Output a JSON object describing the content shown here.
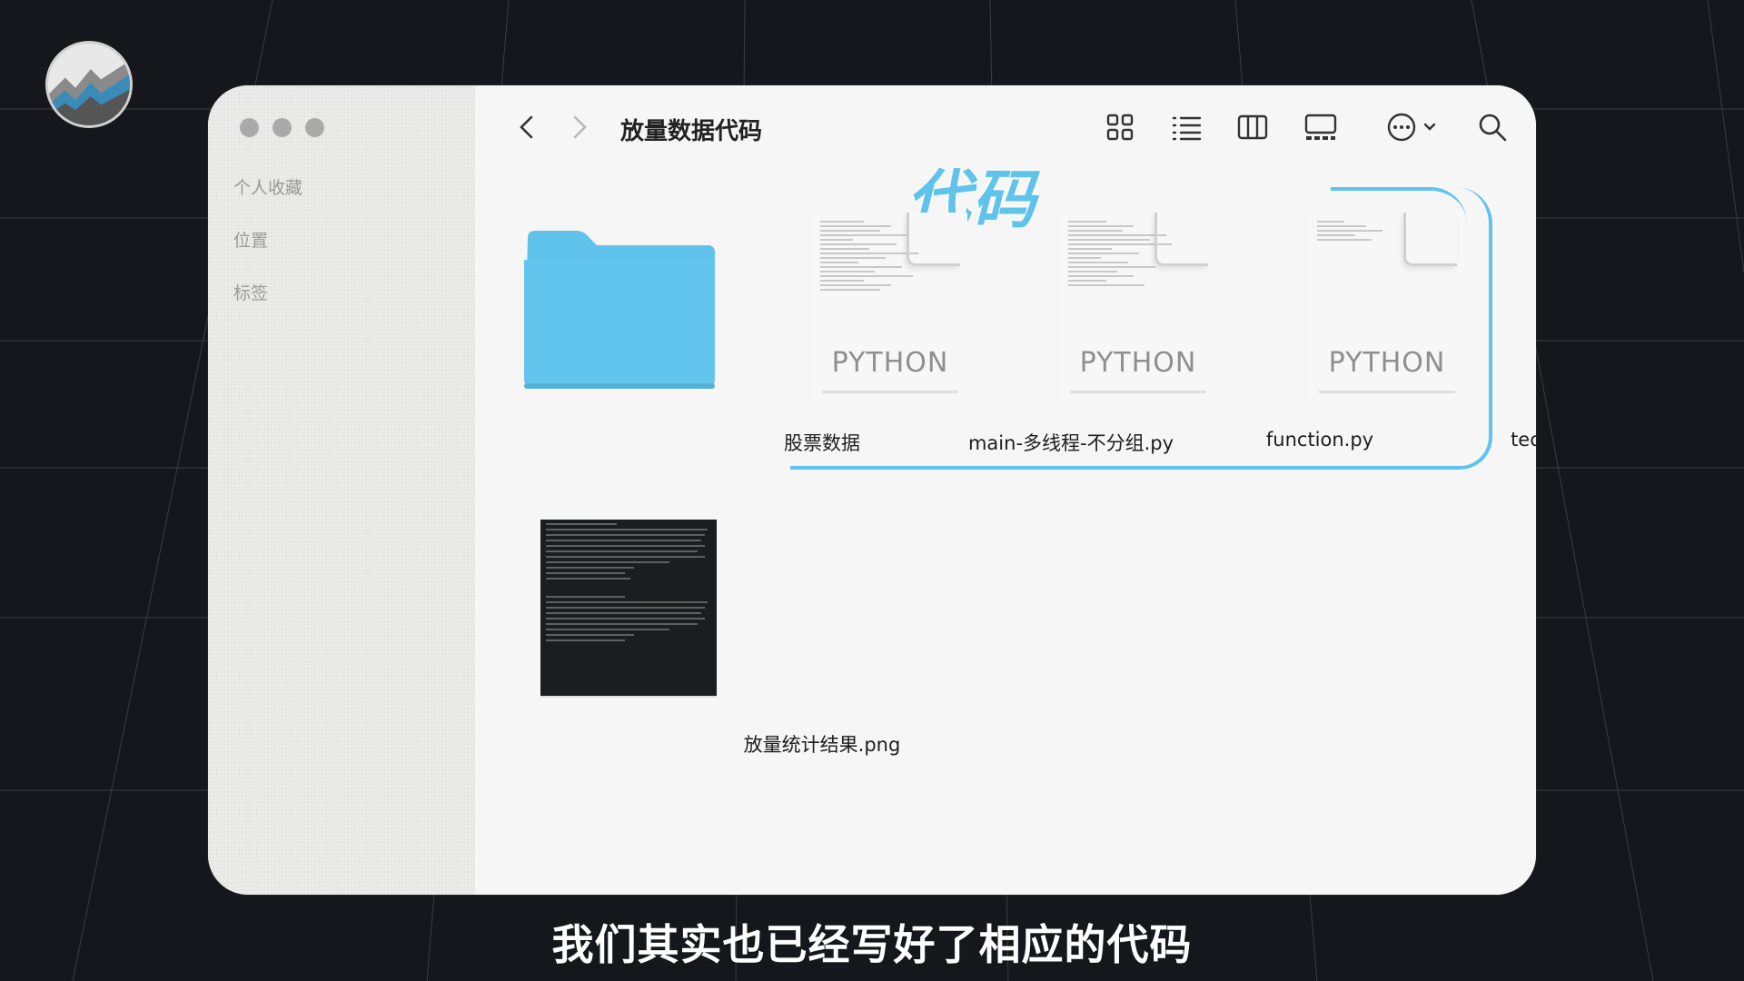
{
  "window": {
    "title": "放量数据代码",
    "sidebar": {
      "items": [
        {
          "label": "个人收藏"
        },
        {
          "label": "位置"
        },
        {
          "label": "标签"
        }
      ]
    }
  },
  "annotation": {
    "label": "代码",
    "color": "#5fc3ec"
  },
  "files": [
    {
      "name": "股票数据",
      "type": "folder",
      "icon": "folder-icon",
      "color": "#5fc3ec"
    },
    {
      "name": "main-多线程-不分组.py",
      "type": "python",
      "icon_text": "PYTHON"
    },
    {
      "name": "function.py",
      "type": "python",
      "icon_text": "PYTHON"
    },
    {
      "name": "technical.py",
      "type": "python",
      "icon_text": "PYTHON"
    },
    {
      "name": "放量统计结果.png",
      "type": "image",
      "icon": "image-thumbnail"
    }
  ],
  "toolbar": {
    "icons": [
      "back-icon",
      "forward-icon",
      "grid-view-icon",
      "list-view-icon",
      "column-view-icon",
      "gallery-view-icon",
      "more-icon",
      "search-icon"
    ]
  },
  "subtitle": "我们其实也已经写好了相应的代码"
}
